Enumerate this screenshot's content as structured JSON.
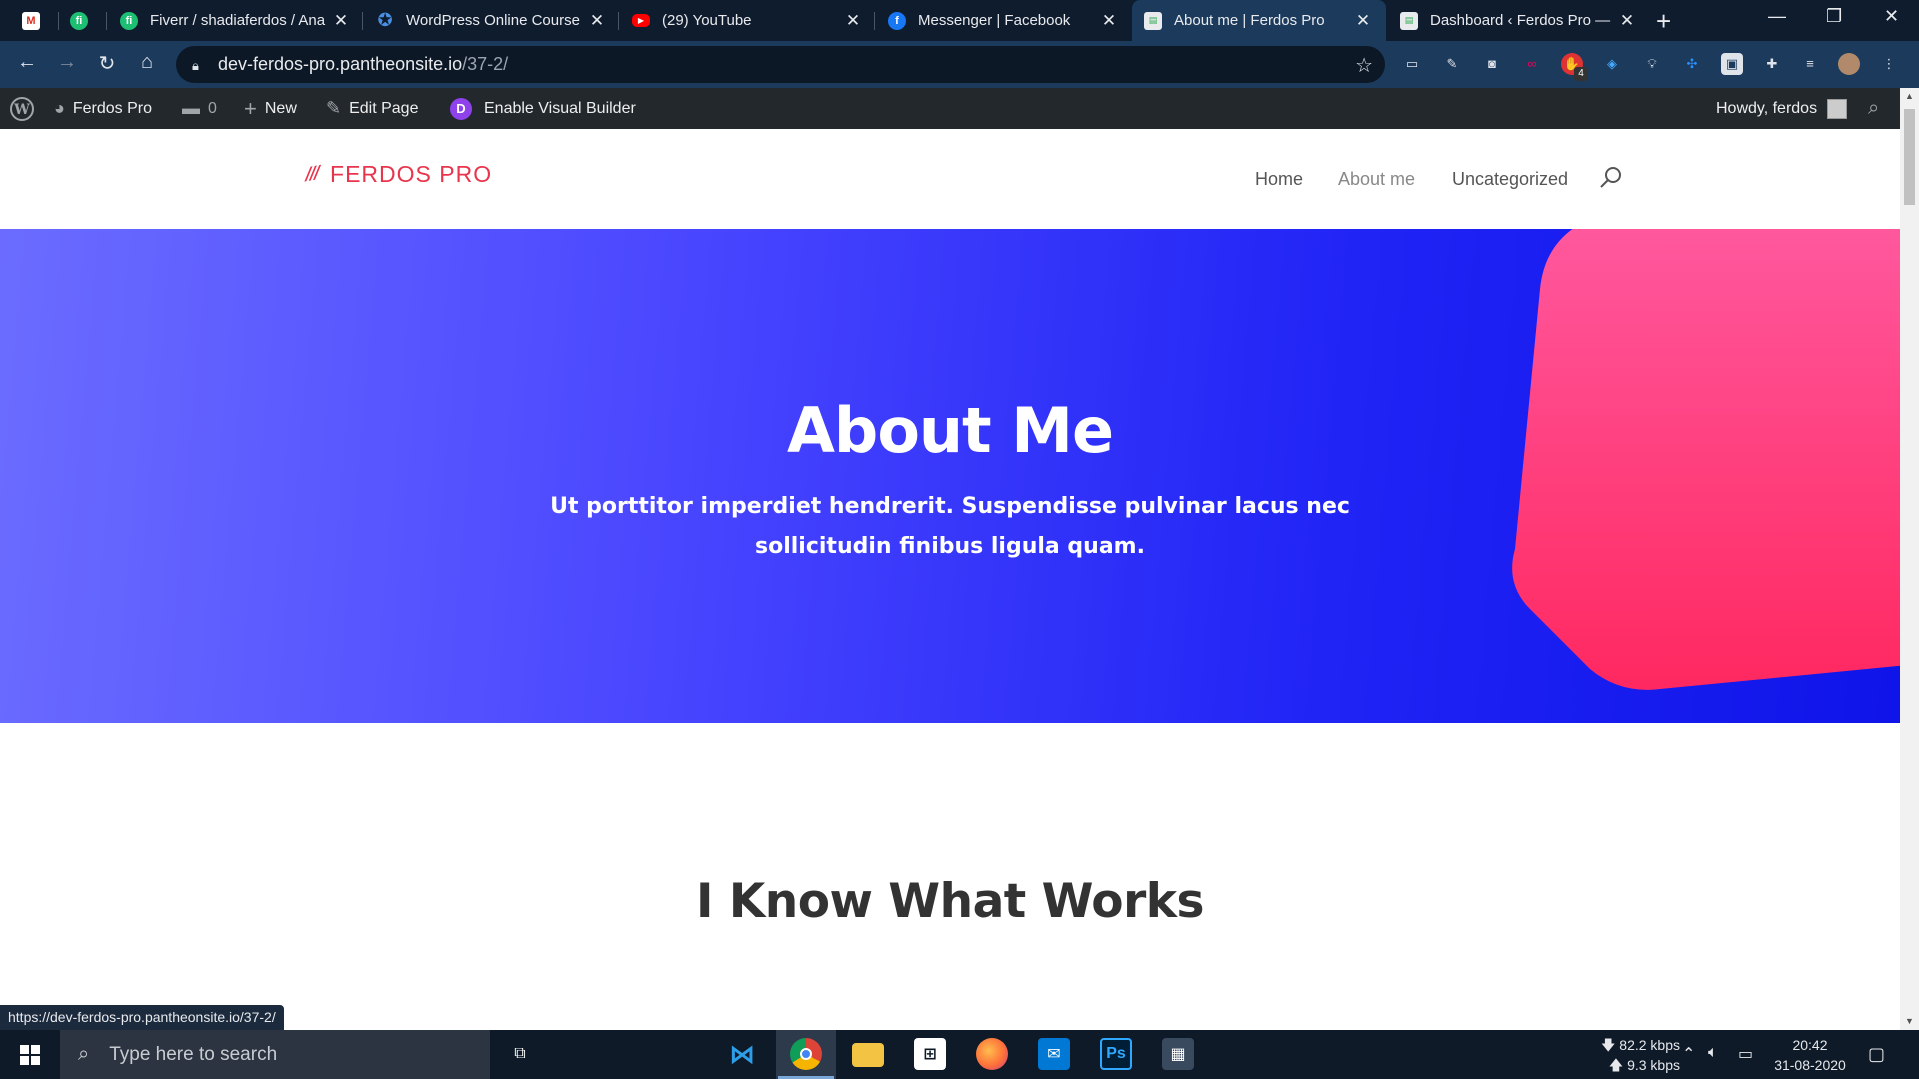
{
  "browser": {
    "tabs": [
      {
        "title": "",
        "favicon": "gmail-icon",
        "color": "#d93025"
      },
      {
        "title": "",
        "favicon": "fiverr-icon",
        "color": "#1dbf73"
      },
      {
        "title": "Fiverr / shadiaferdos / Ana",
        "favicon": "fiverr-icon",
        "color": "#1dbf73"
      },
      {
        "title": "WordPress Online Course",
        "favicon": "course-icon",
        "color": "#4a90e2"
      },
      {
        "title": "(29) YouTube",
        "favicon": "youtube-icon",
        "color": "#ff0000"
      },
      {
        "title": "Messenger | Facebook",
        "favicon": "facebook-icon",
        "color": "#1877f2"
      },
      {
        "title": "About me | Ferdos Pro",
        "favicon": "page-icon",
        "color": "#e8eaed"
      },
      {
        "title": "Dashboard ‹ Ferdos Pro —",
        "favicon": "page-icon",
        "color": "#e8eaed"
      }
    ],
    "url_host": "dev-ferdos-pro.pantheonsite.io",
    "url_path": "/37-2/",
    "status_url": "https://dev-ferdos-pro.pantheonsite.io/37-2/",
    "extension_badge": "4"
  },
  "adminbar": {
    "site_name": "Ferdos Pro",
    "comments_count": "0",
    "new_label": "New",
    "edit_label": "Edit Page",
    "visual_builder_label": "Enable Visual Builder",
    "howdy": "Howdy, ferdos"
  },
  "site": {
    "logo_text": "FERDOS PRO",
    "logo_mark": "⁄⁄⁄",
    "nav": [
      "Home",
      "About me",
      "Uncategorized"
    ]
  },
  "hero": {
    "title": "About Me",
    "subtitle": "Ut porttitor imperdiet hendrerit. Suspendisse pulvinar lacus nec sollicitudin finibus ligula quam."
  },
  "section": {
    "heading": "I Know What Works"
  },
  "taskbar": {
    "search_placeholder": "Type here to search",
    "download_speed": "82.2 kbps",
    "upload_speed": "9.3 kbps",
    "time": "20:42",
    "date": "31-08-2020"
  }
}
